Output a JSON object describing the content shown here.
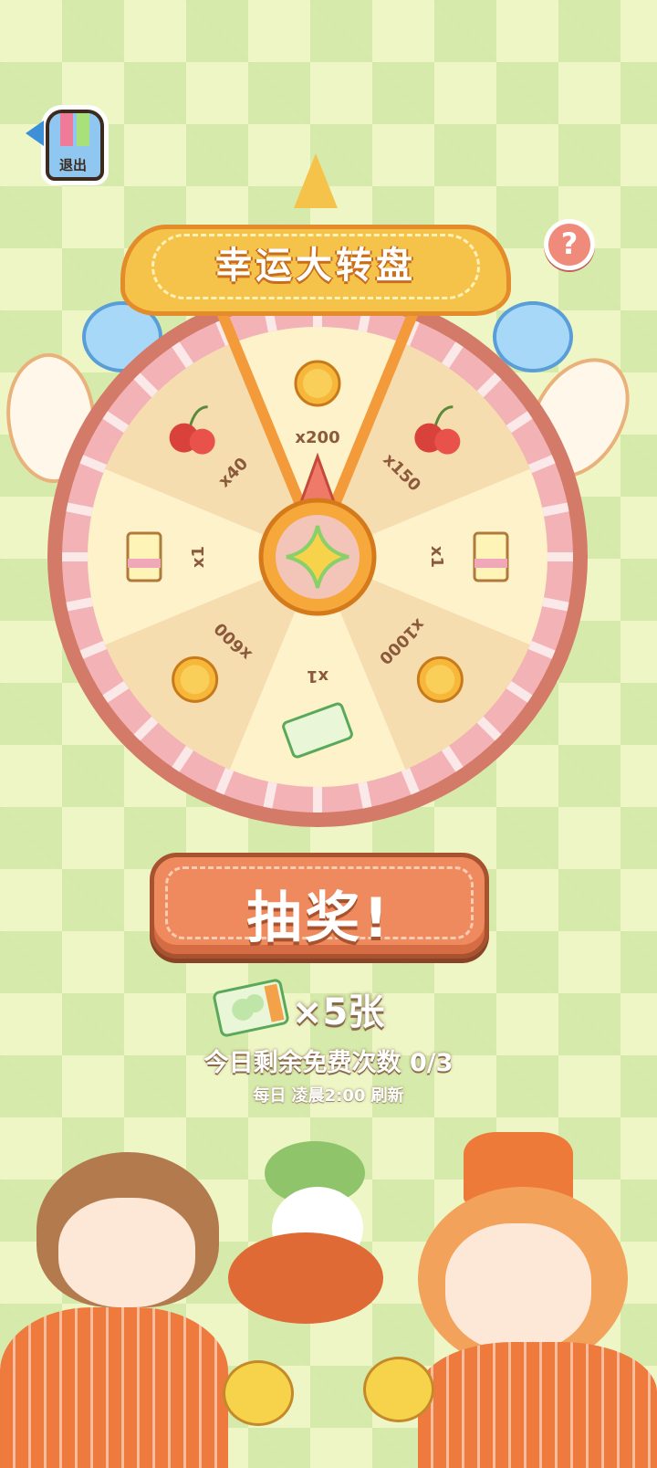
{
  "exit": {
    "label": "退出"
  },
  "help": {
    "label": "?"
  },
  "banner": {
    "title": "幸运大转盘"
  },
  "wheel": {
    "segments": [
      {
        "label": "x200",
        "icon": "coin-icon"
      },
      {
        "label": "x150",
        "icon": "cherry-icon"
      },
      {
        "label": "x1",
        "icon": "card-pack-icon"
      },
      {
        "label": "x1000",
        "icon": "coin-icon"
      },
      {
        "label": "x1",
        "icon": "ticket-icon"
      },
      {
        "label": "x600",
        "icon": "coin-icon"
      },
      {
        "label": "x1",
        "icon": "card-pack-icon"
      },
      {
        "label": "x40",
        "icon": "cherry-icon"
      }
    ],
    "colors": {
      "light": "#fdf2c9",
      "dark": "#f6ddb0",
      "rim": "#f2b2b6",
      "rim_outer": "#d47a68"
    }
  },
  "draw_button": {
    "label": "抽奖!"
  },
  "tickets": {
    "count_label": "×5张"
  },
  "free_draws": {
    "text": "今日剩余免费次数  0/3"
  },
  "refresh": {
    "text": "每日 凌晨2:00 刷新"
  }
}
